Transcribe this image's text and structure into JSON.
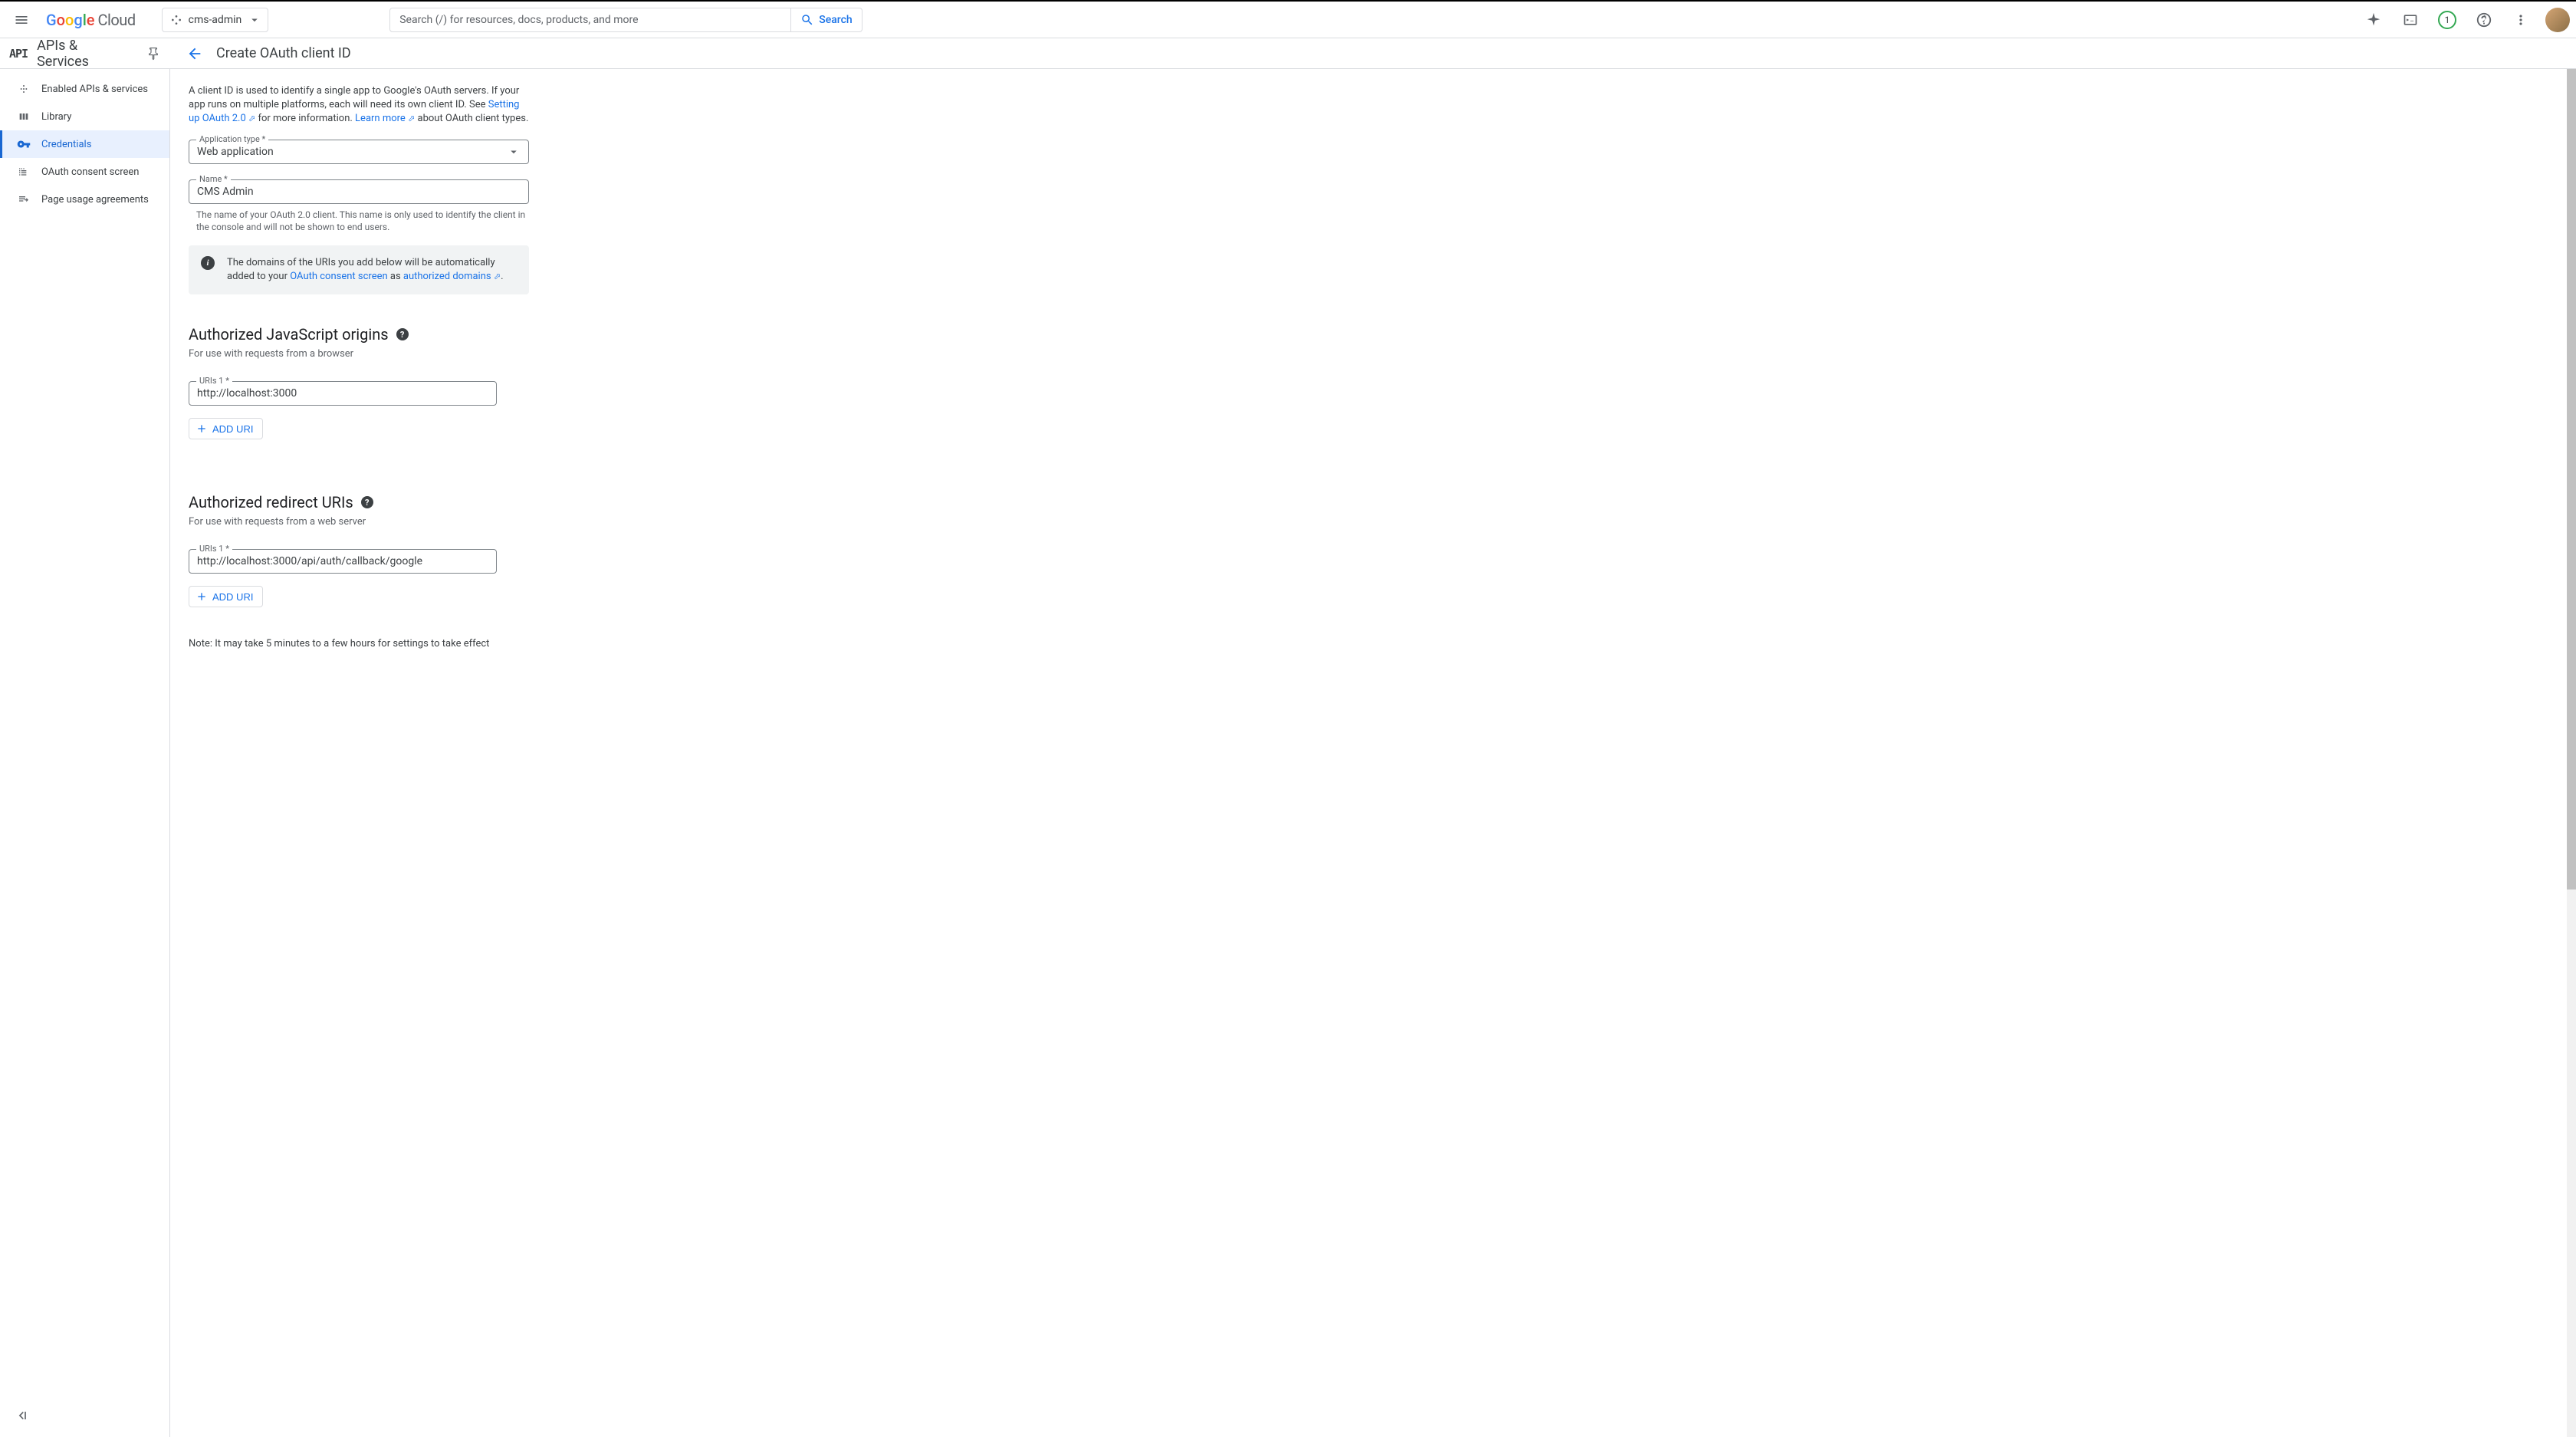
{
  "header": {
    "logo_text": "Google Cloud",
    "project_name": "cms-admin",
    "search_placeholder": "Search (/) for resources, docs, products, and more",
    "search_button": "Search",
    "notification_count": "1"
  },
  "subheader": {
    "api_logo": "API",
    "service_title": "APIs & Services",
    "page_title": "Create OAuth client ID"
  },
  "sidebar": {
    "items": [
      {
        "label": "Enabled APIs & services",
        "icon": "grid"
      },
      {
        "label": "Library",
        "icon": "library"
      },
      {
        "label": "Credentials",
        "icon": "key",
        "active": true
      },
      {
        "label": "OAuth consent screen",
        "icon": "consent"
      },
      {
        "label": "Page usage agreements",
        "icon": "agreements"
      }
    ]
  },
  "main": {
    "intro_1": "A client ID is used to identify a single app to Google's OAuth servers. If your app runs on multiple platforms, each will need its own client ID. See ",
    "intro_link_1": "Setting up OAuth 2.0",
    "intro_2": " for more information. ",
    "intro_link_2": "Learn more",
    "intro_3": " about OAuth client types.",
    "app_type_label": "Application type *",
    "app_type_value": "Web application",
    "name_label": "Name *",
    "name_value": "CMS Admin",
    "name_helper": "The name of your OAuth 2.0 client. This name is only used to identify the client in the console and will not be shown to end users.",
    "info_1": "The domains of the URIs you add below will be automatically added to your ",
    "info_link_1": "OAuth consent screen",
    "info_2": " as ",
    "info_link_2": "authorized domains",
    "info_3": ".",
    "js_origins_title": "Authorized JavaScript origins",
    "js_origins_desc": "For use with requests from a browser",
    "js_uri_label": "URIs 1 *",
    "js_uri_value": "http://localhost:3000",
    "add_uri": "ADD URI",
    "redirect_title": "Authorized redirect URIs",
    "redirect_desc": "For use with requests from a web server",
    "redirect_uri_label": "URIs 1 *",
    "redirect_uri_value": "http://localhost:3000/api/auth/callback/google",
    "note": "Note: It may take 5 minutes to a few hours for settings to take effect"
  }
}
